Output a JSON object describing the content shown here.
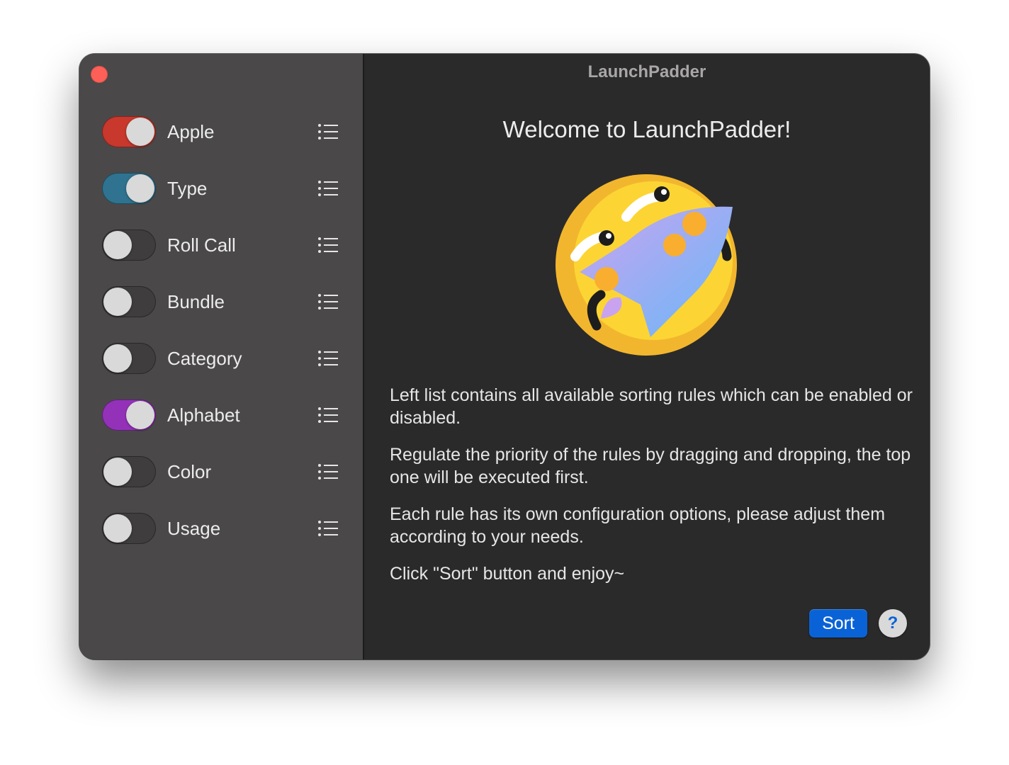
{
  "window": {
    "title": "LaunchPadder"
  },
  "sidebar": {
    "rules": [
      {
        "label": "Apple",
        "enabled": true,
        "color": "#c8382c"
      },
      {
        "label": "Type",
        "enabled": true,
        "color": "#2f7390"
      },
      {
        "label": "Roll Call",
        "enabled": false,
        "color": "#3f3d3e"
      },
      {
        "label": "Bundle",
        "enabled": false,
        "color": "#3f3d3e"
      },
      {
        "label": "Category",
        "enabled": false,
        "color": "#3f3d3e"
      },
      {
        "label": "Alphabet",
        "enabled": true,
        "color": "#9332b8"
      },
      {
        "label": "Color",
        "enabled": false,
        "color": "#3f3d3e"
      },
      {
        "label": "Usage",
        "enabled": false,
        "color": "#3f3d3e"
      }
    ],
    "item_icon": "list-icon"
  },
  "main": {
    "welcome": "Welcome to LaunchPadder!",
    "logo_icon": "rocket-logo-icon",
    "paragraphs": [
      "Left list contains all available sorting rules which can be enabled or disabled.",
      "Regulate the priority of the rules by dragging and dropping, the top one will be executed first.",
      "Each rule has its own configuration options, please adjust them according to your needs.",
      "Click \"Sort\" button and enjoy~"
    ],
    "sort_label": "Sort",
    "help_label": "?"
  },
  "colors": {
    "close": "#fe5f57",
    "accent": "#0a63d6",
    "sidebar_bg": "#4a4849",
    "main_bg": "#2b2a2a"
  }
}
